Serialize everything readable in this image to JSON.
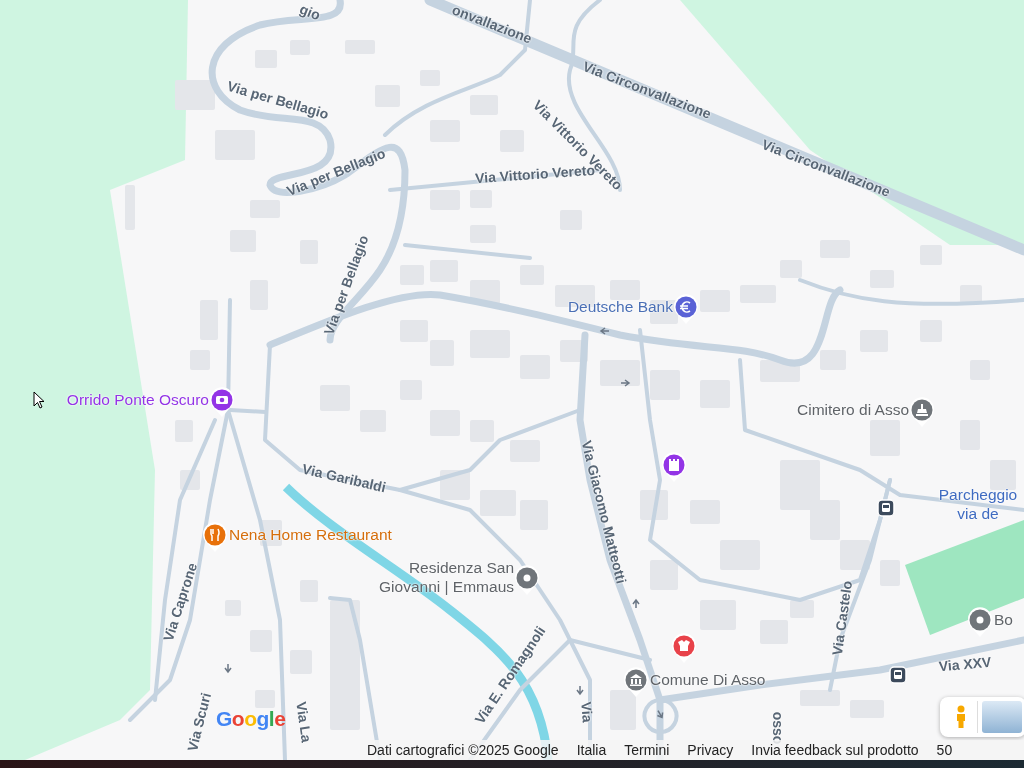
{
  "map": {
    "streets": [
      {
        "text": "gio"
      },
      {
        "text": "onvallazione"
      },
      {
        "text": "Via Circonvallazione"
      },
      {
        "text": "Via Circonvallazione"
      },
      {
        "text": "Via per Bellagio"
      },
      {
        "text": "Via per Bellagio"
      },
      {
        "text": "Via per Bellagio"
      },
      {
        "text": "Via Vittorio Vereto"
      },
      {
        "text": "Via Vittorio Vereto"
      },
      {
        "text": "Via Garibaldi"
      },
      {
        "text": "Via Giacomo Matteotti"
      },
      {
        "text": "Via Caprone"
      },
      {
        "text": "Via E. Romagnoli"
      },
      {
        "text": "Via Scuri"
      },
      {
        "text": "Via La"
      },
      {
        "text": "Via"
      },
      {
        "text": "Via Castelo"
      },
      {
        "text": "osso"
      },
      {
        "text": "Via XXV"
      }
    ],
    "places": [
      {
        "kind": "attraction",
        "lines": [
          "Orrido Ponte Oscuro"
        ]
      },
      {
        "kind": "bank",
        "lines": [
          "Deutsche Bank"
        ]
      },
      {
        "kind": "generic",
        "lines": [
          "Cimitero di Asso"
        ]
      },
      {
        "kind": "attraction"
      },
      {
        "kind": "food",
        "lines": [
          "Nena Home Restaurant"
        ]
      },
      {
        "kind": "generic",
        "lines": [
          "Residenza San",
          "Giovanni | Emmaus"
        ]
      },
      {
        "kind": "shop"
      },
      {
        "kind": "generic",
        "lines": [
          "Comune Di Asso"
        ]
      },
      {
        "kind": "parking",
        "lines": [
          "Parcheggio",
          "via de"
        ]
      },
      {
        "kind": "generic",
        "lines": [
          "Bo"
        ]
      },
      {
        "kind": "transit"
      },
      {
        "kind": "transit"
      }
    ]
  },
  "logo": "Google",
  "footer": [
    "Dati cartografici ©2025 Google",
    "Italia",
    "Termini",
    "Privacy",
    "Invia feedback sul prodotto",
    "50"
  ]
}
